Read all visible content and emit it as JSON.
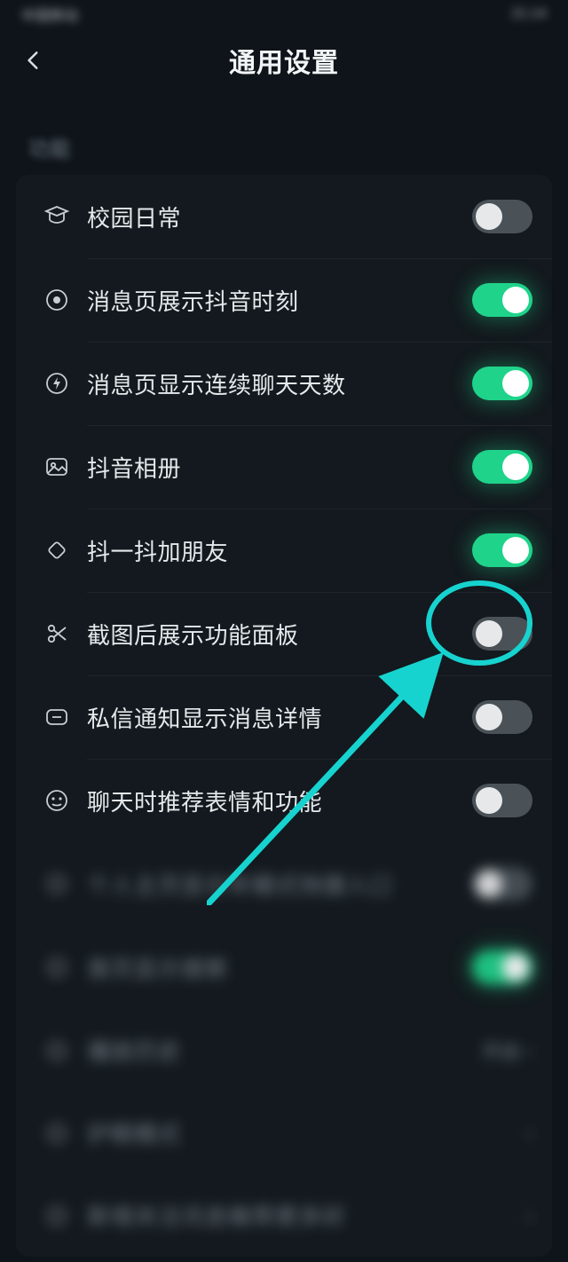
{
  "status": {
    "left": "中国移动",
    "right": "21:14"
  },
  "header": {
    "title": "通用设置"
  },
  "section": {
    "label": "功能"
  },
  "rows": [
    {
      "icon": "graduation-cap-icon",
      "label": "校园日常",
      "toggle": "off"
    },
    {
      "icon": "target-icon",
      "label": "消息页展示抖音时刻",
      "toggle": "on"
    },
    {
      "icon": "bolt-circle-icon",
      "label": "消息页显示连续聊天天数",
      "toggle": "on"
    },
    {
      "icon": "photo-icon",
      "label": "抖音相册",
      "toggle": "on"
    },
    {
      "icon": "shake-icon",
      "label": "抖一抖加朋友",
      "toggle": "on"
    },
    {
      "icon": "scissors-icon",
      "label": "截图后展示功能面板",
      "toggle": "off",
      "highlighted": true
    },
    {
      "icon": "message-icon",
      "label": "私信通知显示消息详情",
      "toggle": "off"
    },
    {
      "icon": "face-icon",
      "label": "聊天时推荐表情和功能",
      "toggle": "off"
    }
  ],
  "blurred_rows": [
    {
      "label": "个人主页显示年模式快捷入口",
      "toggle": "off"
    },
    {
      "label": "首页显示搜索",
      "toggle": "on"
    },
    {
      "label": "播放历史",
      "right_text": "开启"
    },
    {
      "label": "护眼模式",
      "right_text": ""
    },
    {
      "label": "新增关注讯息推荐更多好",
      "right_text": ""
    }
  ],
  "annotation": {
    "target_row_index": 5
  }
}
